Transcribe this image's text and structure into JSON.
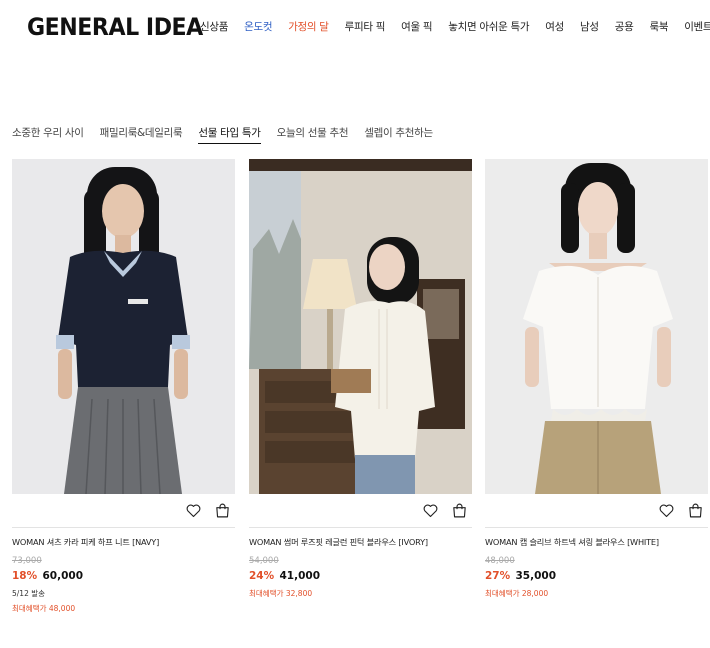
{
  "header": {
    "logo": "GENERAL IDEA",
    "nav": [
      {
        "label": "신상품",
        "color": "#222222"
      },
      {
        "label": "온도컷",
        "color": "#2f5fc4"
      },
      {
        "label": "가정의 달",
        "color": "#e2502a"
      },
      {
        "label": "루피타 픽",
        "color": "#222222"
      },
      {
        "label": "여울 픽",
        "color": "#222222"
      },
      {
        "label": "놓치면 아쉬운 특가",
        "color": "#222222"
      },
      {
        "label": "여성",
        "color": "#222222"
      },
      {
        "label": "남성",
        "color": "#222222"
      },
      {
        "label": "공용",
        "color": "#222222"
      },
      {
        "label": "룩북",
        "color": "#222222"
      },
      {
        "label": "이벤트",
        "color": "#222222"
      }
    ]
  },
  "tabs": [
    {
      "label": "소중한 우리 사이",
      "active": false
    },
    {
      "label": "패밀리룩&데일리룩",
      "active": false
    },
    {
      "label": "선물 타입 특가",
      "active": true
    },
    {
      "label": "오늘의 선물 추천",
      "active": false
    },
    {
      "label": "셀렙이 추천하는",
      "active": false
    }
  ],
  "products": [
    {
      "name": "WOMAN 셔츠 카라 피케 하프 니트 [NAVY]",
      "original_price": "73,000",
      "discount": "18%",
      "price": "60,000",
      "shipping": "5/12 발송",
      "benefit": "최대혜택가 48,000"
    },
    {
      "name": "WOMAN 썸머 루즈핏 레글런 핀턱 블라우스 [IVORY]",
      "original_price": "54,000",
      "discount": "24%",
      "price": "41,000",
      "benefit": "최대혜택가 32,800"
    },
    {
      "name": "WOMAN 캡 슬리브 하트넥 셔링 블라우스 [WHITE]",
      "original_price": "48,000",
      "discount": "27%",
      "price": "35,000",
      "benefit": "최대혜택가 28,000"
    }
  ],
  "icons": {
    "wishlist": "heart-icon",
    "cart": "shopping-bag-icon"
  },
  "colors": {
    "accent": "#e2502a",
    "text": "#111111",
    "strike": "#aaaaaa"
  }
}
